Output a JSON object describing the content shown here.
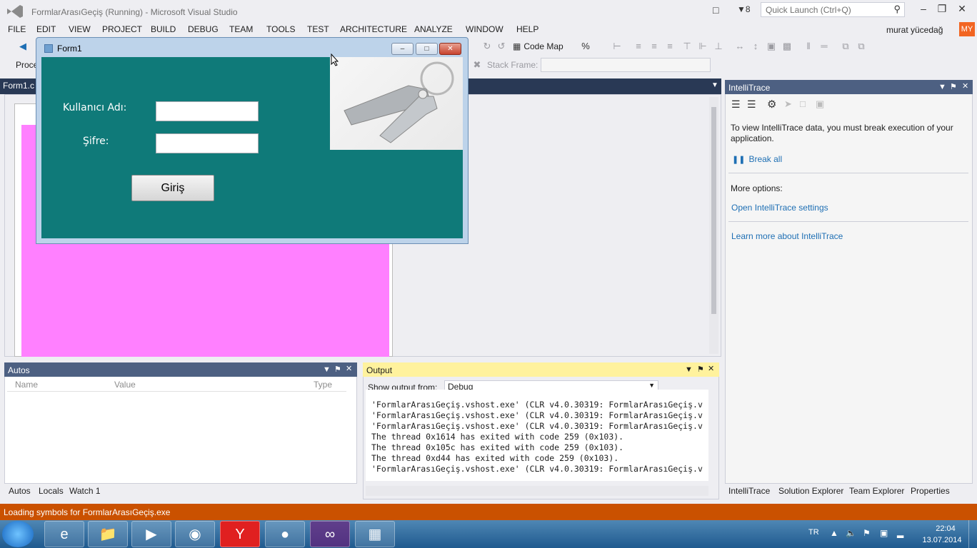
{
  "window": {
    "title": "FormlarArasıGeçiş (Running) - Microsoft Visual Studio",
    "notification_count": "8",
    "quick_launch_placeholder": "Quick Launch (Ctrl+Q)"
  },
  "menu": [
    "FILE",
    "EDIT",
    "VIEW",
    "PROJECT",
    "BUILD",
    "DEBUG",
    "TEAM",
    "TOOLS",
    "TEST",
    "ARCHITECTURE",
    "ANALYZE",
    "WINDOW",
    "HELP"
  ],
  "user": {
    "name": "murat yücedağ",
    "initials": "MY"
  },
  "toolbar": {
    "code_map": "Code Map",
    "process_label": "Proce",
    "stack_frame_label": "Stack Frame:"
  },
  "document": {
    "tab": "Form1.c"
  },
  "form1": {
    "title": "Form1",
    "user_label": "Kullanıcı Adı:",
    "password_label": "Şifre:",
    "login_button": "Giriş"
  },
  "autos": {
    "title": "Autos",
    "columns": [
      "Name",
      "Value",
      "Type"
    ],
    "tabs": [
      "Autos",
      "Locals",
      "Watch 1"
    ]
  },
  "output": {
    "title": "Output",
    "show_from_label": "Show output from:",
    "show_from_value": "Debug",
    "lines": [
      "'FormlarArasıGeçiş.vshost.exe' (CLR v4.0.30319: FormlarArasıGeçiş.v",
      "'FormlarArasıGeçiş.vshost.exe' (CLR v4.0.30319: FormlarArasıGeçiş.v",
      "'FormlarArasıGeçiş.vshost.exe' (CLR v4.0.30319: FormlarArasıGeçiş.v",
      "The thread 0x1614 has exited with code 259 (0x103).",
      "The thread 0x105c has exited with code 259 (0x103).",
      "The thread 0xd44 has exited with code 259 (0x103).",
      "'FormlarArasıGeçiş.vshost.exe' (CLR v4.0.30319: FormlarArasıGeçiş.v"
    ]
  },
  "intellitrace": {
    "title": "IntelliTrace",
    "message": "To view IntelliTrace data, you must break execution of your application.",
    "break_all": "Break all",
    "more_options": "More options:",
    "open_settings": "Open IntelliTrace settings",
    "learn_more": "Learn more about IntelliTrace"
  },
  "right_tabs": [
    "IntelliTrace",
    "Solution Explorer",
    "Team Explorer",
    "Properties"
  ],
  "status": {
    "text": "Loading symbols for FormlarArasıGeçiş.exe"
  },
  "taskbar": {
    "language": "TR",
    "time": "22:04",
    "date": "13.07.2014"
  },
  "colors": {
    "accent": "#68217a",
    "status_bar": "#ca5100",
    "panel_header": "#4d6082",
    "output_header": "#fff29d",
    "form_bg": "#0f7a79",
    "designer_pink": "#ff80ff"
  }
}
